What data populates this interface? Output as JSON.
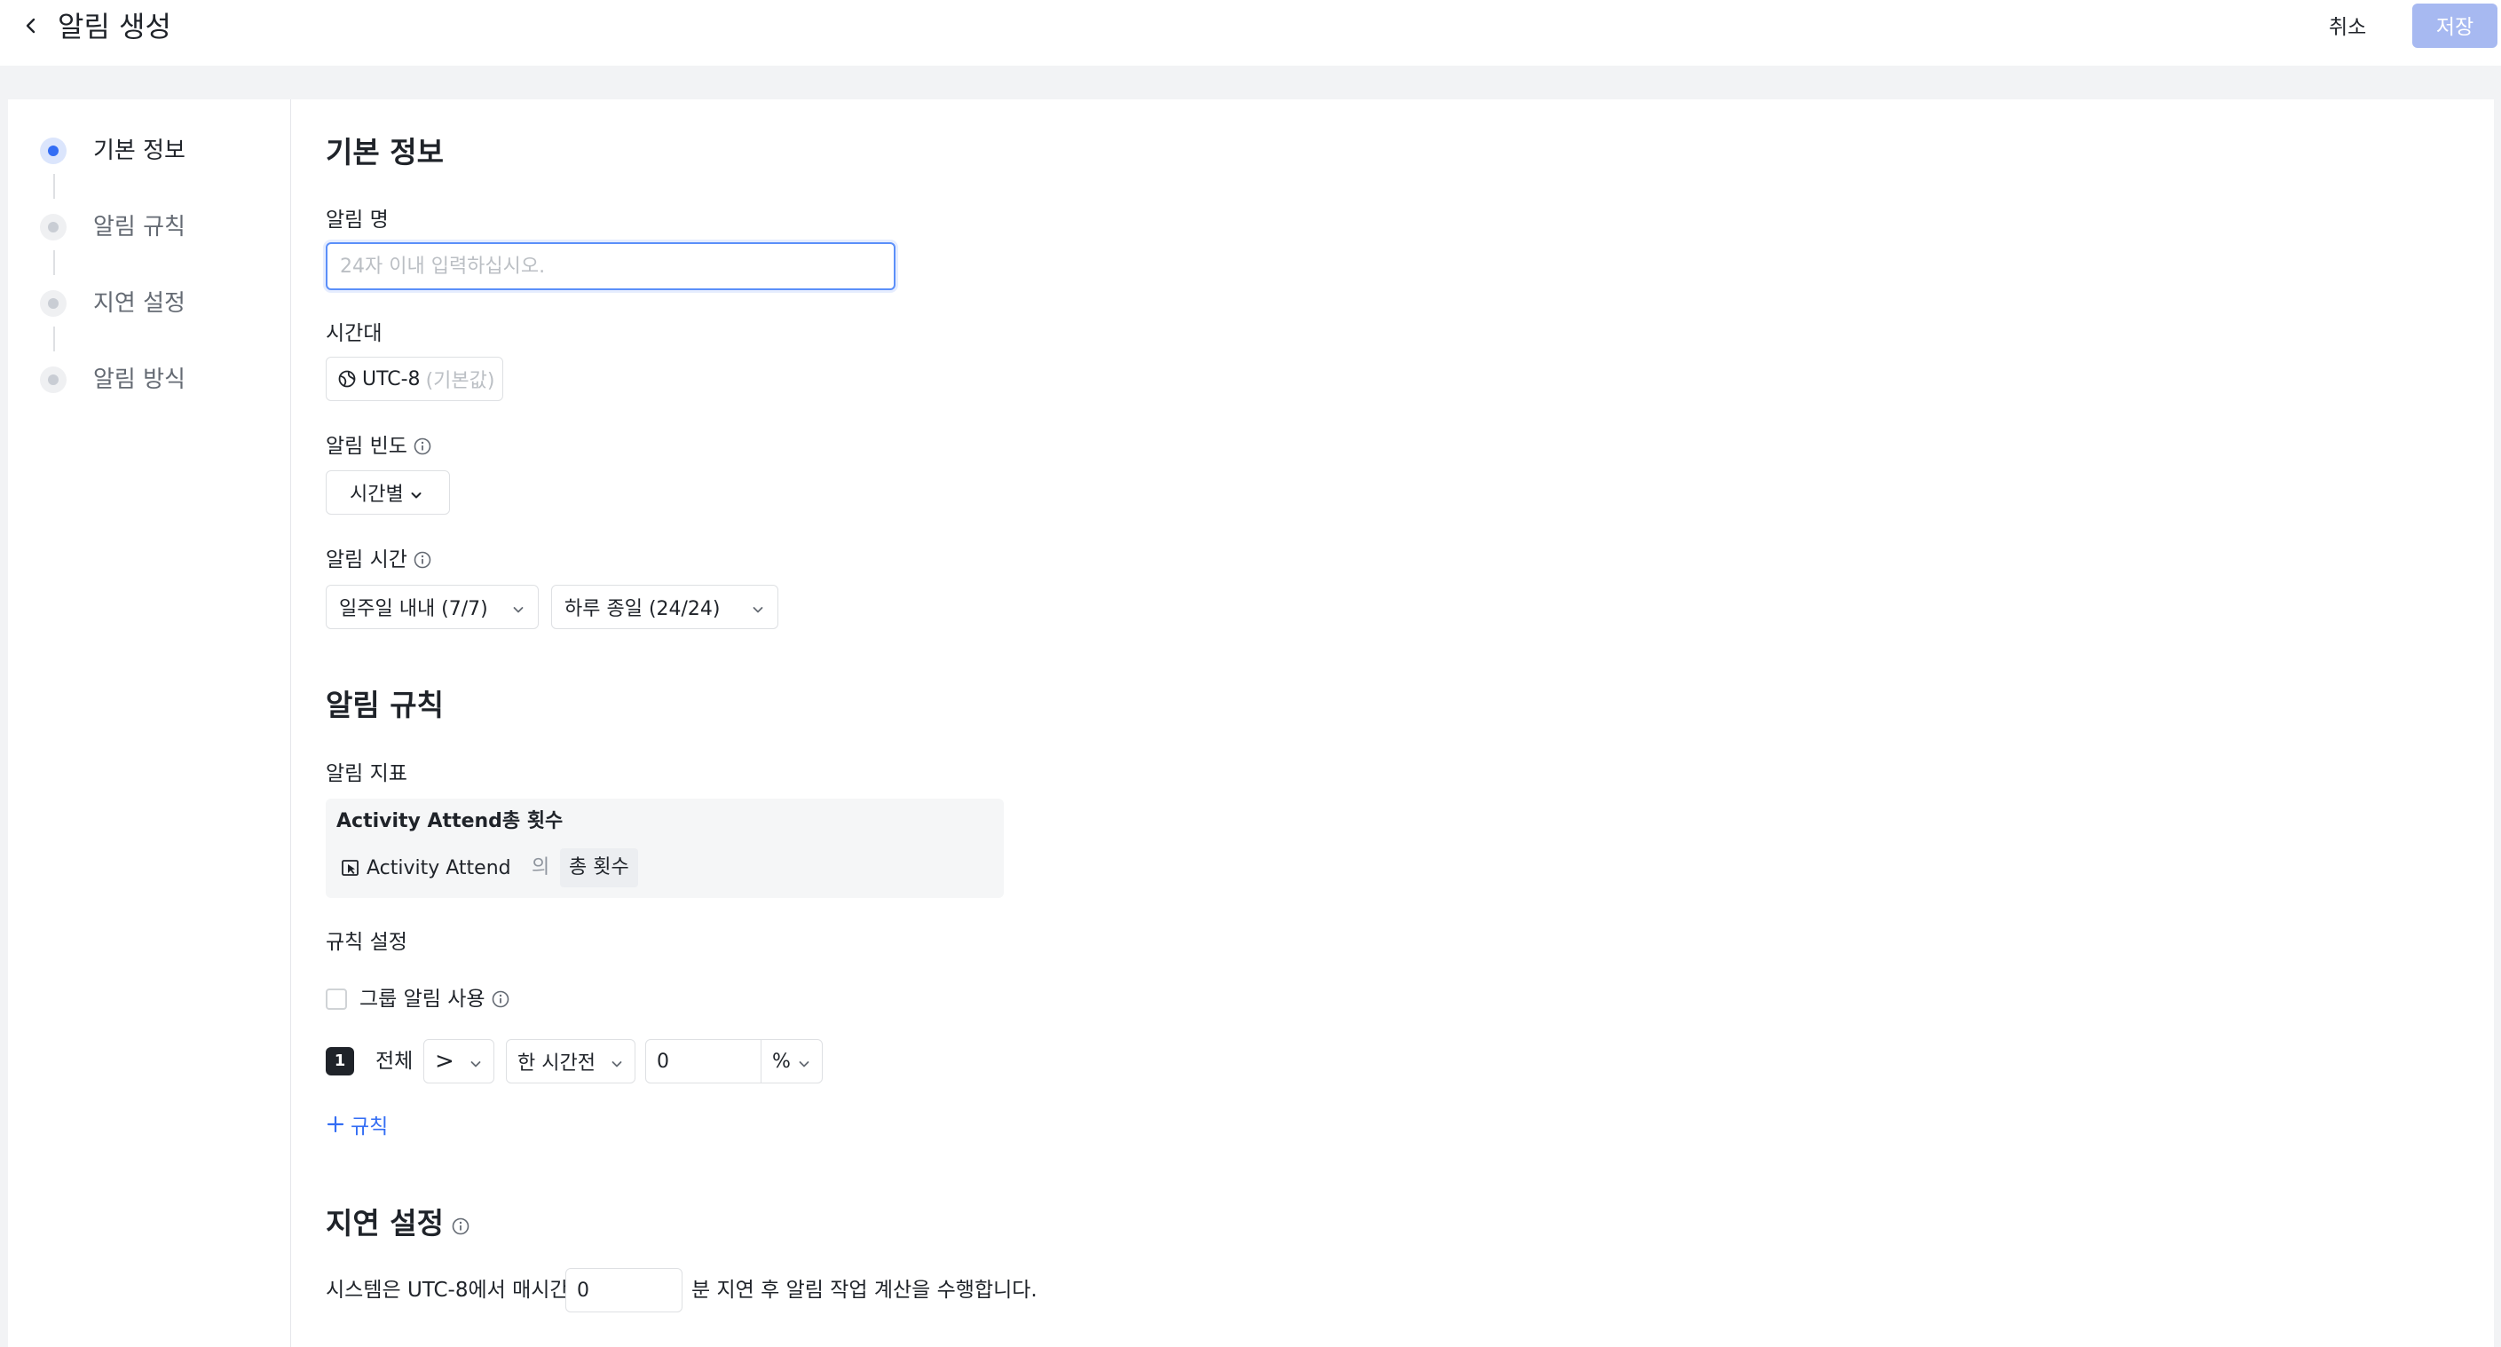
{
  "header": {
    "title": "알림 생성",
    "cancel_label": "취소",
    "save_label": "저장"
  },
  "sidebar": {
    "steps": [
      {
        "label": "기본 정보",
        "active": true
      },
      {
        "label": "알림 규칙",
        "active": false
      },
      {
        "label": "지연 설정",
        "active": false
      },
      {
        "label": "알림 방식",
        "active": false
      }
    ]
  },
  "basic": {
    "section_title": "기본 정보",
    "name_label": "알림 명",
    "name_placeholder": "24자 이내 입력하십시오.",
    "name_value": "",
    "timezone_label": "시간대",
    "timezone_value": "UTC-8",
    "timezone_default": "(기본값)",
    "frequency_label": "알림 빈도",
    "frequency_value": "시간별",
    "time_label": "알림 시간",
    "days_value": "일주일 내내 (7/7)",
    "hours_value": "하루 종일 (24/24)"
  },
  "rules": {
    "section_title": "알림 규칙",
    "metric_label": "알림 지표",
    "metric_title": "Activity Attend총 횟수",
    "metric_event": "Activity Attend",
    "metric_of": "의",
    "metric_measure": "총 횟수",
    "rule_settings_label": "규칙 설정",
    "group_alert_label": "그룹 알림 사용",
    "rule_row": {
      "index": "1",
      "scope": "전체",
      "operator": ">",
      "period": "한 시간전",
      "value": "0",
      "unit": "%"
    },
    "add_rule_label": "규칙"
  },
  "delay": {
    "section_title": "지연 설정",
    "prefix": "시스템은 UTC-8에서 매시간",
    "value": "0",
    "suffix": "분 지연 후 알림 작업 계산을 수행합니다."
  },
  "colors": {
    "accent": "#336df4",
    "save_disabled": "#a7b9f1",
    "page_bg": "#f2f3f5"
  },
  "icons": [
    "back-arrow-icon",
    "globe-icon",
    "chevron-down-icon",
    "info-icon",
    "event-icon",
    "plus-icon"
  ]
}
